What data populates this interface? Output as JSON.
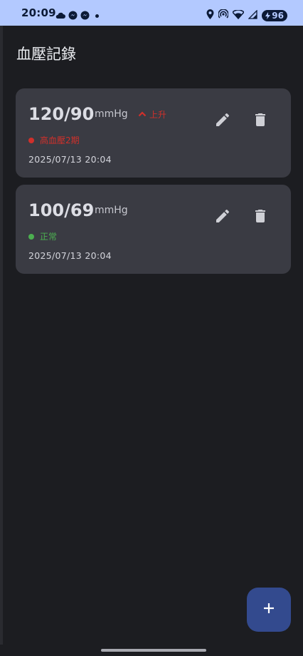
{
  "status_bar": {
    "time": "20:09",
    "battery": "96",
    "left_icons": [
      "cloud-icon",
      "messenger-icon",
      "messenger-icon",
      "dot-icon"
    ],
    "right_icons": [
      "location-icon",
      "hotspot-icon",
      "wifi-icon",
      "signal-icon",
      "battery-icon"
    ]
  },
  "app_bar": {
    "title": "血壓記錄"
  },
  "records": [
    {
      "value": "120/90",
      "unit": "mmHg",
      "trend_label": "上升",
      "trend_icon": "chevron-up-icon",
      "status_label": "高血壓2期",
      "status_color": "#d0302b",
      "timestamp": "2025/07/13 20:04"
    },
    {
      "value": "100/69",
      "unit": "mmHg",
      "status_label": "正常",
      "status_color": "#4caf50",
      "timestamp": "2025/07/13 20:04"
    }
  ],
  "actions": {
    "edit_icon": "edit-icon",
    "delete_icon": "delete-icon"
  },
  "fab": {
    "label": "+",
    "icon": "plus-icon"
  },
  "colors": {
    "background": "#1c1d21",
    "card": "#3a3b43",
    "status_bar": "#b3c9ff",
    "fab": "#334a8e",
    "danger": "#d0302b",
    "ok": "#4caf50"
  }
}
